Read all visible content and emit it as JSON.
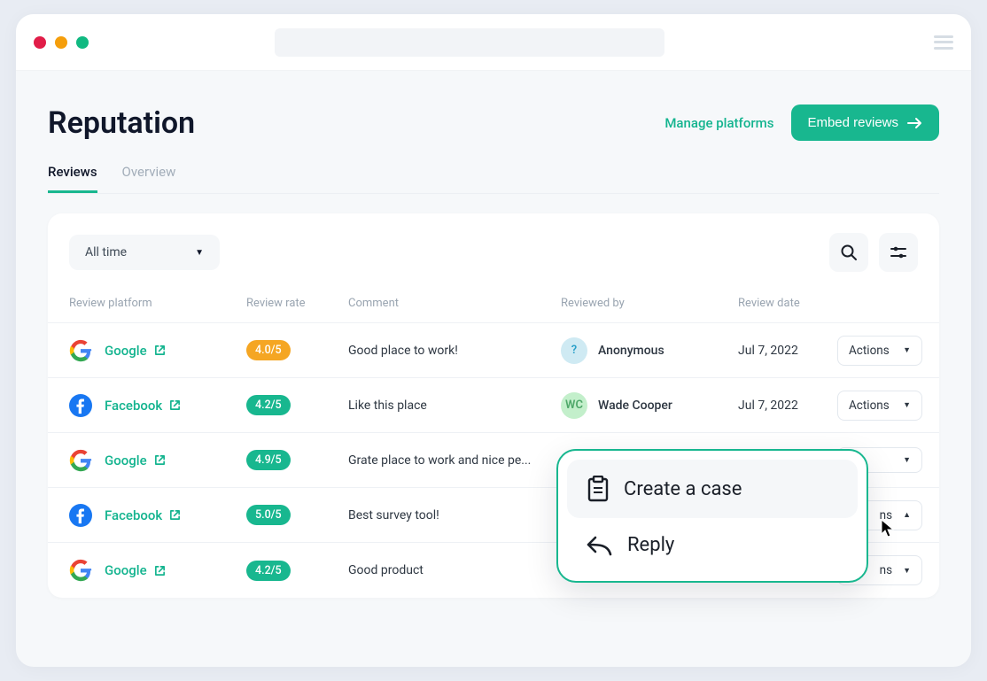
{
  "page": {
    "title": "Reputation",
    "manage_link": "Manage platforms",
    "embed_button": "Embed reviews"
  },
  "tabs": [
    {
      "label": "Reviews",
      "active": true
    },
    {
      "label": "Overview",
      "active": false
    }
  ],
  "toolbar": {
    "time_filter": "All time"
  },
  "columns": {
    "platform": "Review platform",
    "rate": "Review rate",
    "comment": "Comment",
    "reviewer": "Reviewed by",
    "date": "Review date"
  },
  "rows": [
    {
      "platform": "Google",
      "rate": "4.0/5",
      "rate_class": "rate-amber",
      "comment": "Good place to work!",
      "reviewer": "Anonymous",
      "avatar": {
        "text": "?",
        "bg": "#cfeaf3",
        "fg": "#2aa0c9"
      },
      "date": "Jul 7, 2022",
      "action": "Actions",
      "caret": "▼"
    },
    {
      "platform": "Facebook",
      "rate": "4.2/5",
      "rate_class": "rate-green",
      "comment": "Like this place",
      "reviewer": "Wade Cooper",
      "avatar": {
        "text": "WC",
        "bg": "#c3efcb",
        "fg": "#4fa86a"
      },
      "date": "Jul 7, 2022",
      "action": "Actions",
      "caret": "▼"
    },
    {
      "platform": "Google",
      "rate": "4.9/5",
      "rate_class": "rate-green",
      "comment": "Grate place to work and nice pe...",
      "reviewer": "",
      "avatar": null,
      "date": "",
      "action": "",
      "caret": "▼"
    },
    {
      "platform": "Facebook",
      "rate": "5.0/5",
      "rate_class": "rate-green",
      "comment": "Best survey tool!",
      "reviewer": "",
      "avatar": null,
      "date": "",
      "action": "ns",
      "caret": "▲"
    },
    {
      "platform": "Google",
      "rate": "4.2/5",
      "rate_class": "rate-green",
      "comment": "Good product",
      "reviewer": "",
      "avatar": null,
      "date": "",
      "action": "ns",
      "caret": "▼"
    }
  ],
  "dropdown": {
    "create_case": "Create a case",
    "reply": "Reply"
  }
}
